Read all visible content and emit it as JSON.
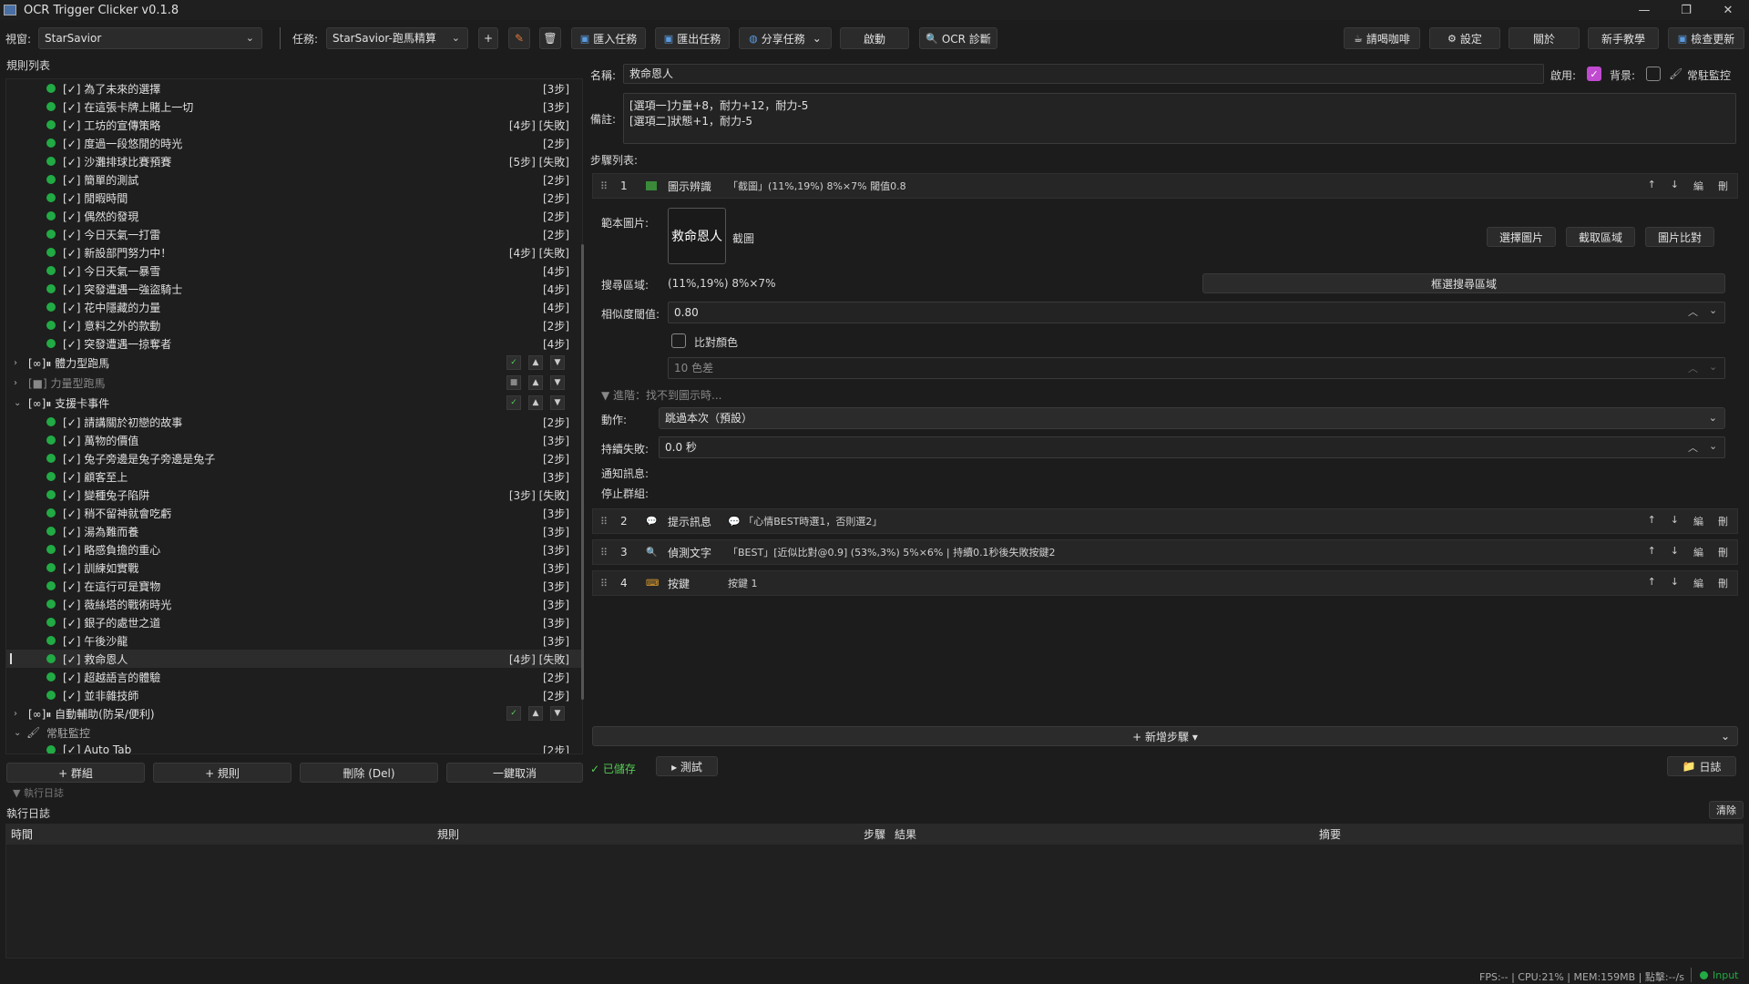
{
  "window": {
    "title": "OCR Trigger Clicker v0.1.8",
    "minimize": "—",
    "maximize": "❐",
    "close": "✕"
  },
  "toolbar": {
    "window_label": "視窗:",
    "window_value": "StarSavior",
    "task_label": "任務:",
    "task_value": "StarSavior-跑馬精算",
    "add": "+",
    "import": "匯入任務",
    "export": "匯出任務",
    "share": "分享任務",
    "start": "啟動",
    "ocr_diag": "OCR 診斷",
    "coffee": "請喝咖啡",
    "settings": "設定",
    "about": "關於",
    "tutorial": "新手教學",
    "update": "檢查更新"
  },
  "rules_title": "規則列表",
  "rules": [
    {
      "text": "[✓] 為了未來的選擇",
      "meta": "[3步]"
    },
    {
      "text": "[✓] 在這張卡牌上賭上一切",
      "meta": "[3步]"
    },
    {
      "text": "[✓] 工坊的宣傳策略",
      "meta": "[4步] [失敗]"
    },
    {
      "text": "[✓] 度過一段悠閒的時光",
      "meta": "[2步]"
    },
    {
      "text": "[✓] 沙灘排球比賽預賽",
      "meta": "[5步] [失敗]"
    },
    {
      "text": "[✓] 簡單的測試",
      "meta": "[2步]"
    },
    {
      "text": "[✓] 閒暇時間",
      "meta": "[2步]"
    },
    {
      "text": "[✓] 偶然的發現",
      "meta": "[2步]"
    },
    {
      "text": "[✓] 今日天氣一打雷",
      "meta": "[2步]"
    },
    {
      "text": "[✓] 新設部門努力中！",
      "meta": "[4步] [失敗]"
    },
    {
      "text": "[✓] 今日天氣一暴雪",
      "meta": "[4步]"
    },
    {
      "text": "[✓] 突發遭遇一強盜騎士",
      "meta": "[4步]"
    },
    {
      "text": "[✓] 花中隱藏的力量",
      "meta": "[4步]"
    },
    {
      "text": "[✓] 意料之外的款動",
      "meta": "[2步]"
    },
    {
      "text": "[✓] 突發遭遇一掠奪者",
      "meta": "[4步]"
    }
  ],
  "groups": {
    "g1": {
      "label": "[∞]⏸ 體力型跑馬"
    },
    "g2": {
      "label": "[■] 力量型跑馬"
    },
    "g3": {
      "label": "[∞]⏸ 支援卡事件"
    },
    "g4": {
      "label": "[∞]⏸ 自動輔助(防呆/便利)"
    },
    "g5": {
      "label": "常駐監控"
    }
  },
  "group_btns": {
    "ok": "✓",
    "up": "▲",
    "down": "▼",
    "stop": "■"
  },
  "rules2": [
    {
      "text": "[✓] 請講關於初戀的故事",
      "meta": "[2步]"
    },
    {
      "text": "[✓] 萬物的價值",
      "meta": "[3步]"
    },
    {
      "text": "[✓] 兔子旁邊是兔子旁邊是兔子",
      "meta": "[2步]"
    },
    {
      "text": "[✓] 顧客至上",
      "meta": "[3步]"
    },
    {
      "text": "[✓] 變種兔子陷阱",
      "meta": "[3步] [失敗]"
    },
    {
      "text": "[✓] 稍不留神就會吃虧",
      "meta": "[3步]"
    },
    {
      "text": "[✓] 湯為難而養",
      "meta": "[3步]"
    },
    {
      "text": "[✓] 略感負擔的重心",
      "meta": "[3步]"
    },
    {
      "text": "[✓] 訓練如實戰",
      "meta": "[3步]"
    },
    {
      "text": "[✓] 在這行可是寶物",
      "meta": "[3步]"
    },
    {
      "text": "[✓] 薇絲塔的戰術時光",
      "meta": "[3步]"
    },
    {
      "text": "[✓] 銀子的處世之道",
      "meta": "[3步]"
    },
    {
      "text": "[✓] 午後沙龍",
      "meta": "[3步]"
    },
    {
      "text": "[✓] 救命恩人",
      "meta": "[4步] [失敗]"
    },
    {
      "text": "[✓] 超越語言的體驗",
      "meta": "[2步]"
    },
    {
      "text": "[✓] 並非雜技師",
      "meta": "[2步]"
    }
  ],
  "auto_tab": {
    "text": "[✓] Auto Tab",
    "meta": "[2步]"
  },
  "bottom_btns": {
    "add_group": "+ 群組",
    "add_rule": "+ 規則",
    "delete": "刪除 (Del)",
    "cancel_all": "一鍵取消"
  },
  "detail": {
    "name_label": "名稱:",
    "name_value": "救命恩人",
    "enable_label": "啟用:",
    "bg_label": "背景:",
    "monitor_label": "常駐監控",
    "note_label": "備註:",
    "note_line1": "[選項一]力量+8，耐力+12，耐力-5",
    "note_line2": "[選項二]狀態+1，耐力-5",
    "steps_label": "步驟列表:"
  },
  "step1": {
    "num": "1",
    "name": "圖示辨識",
    "desc": "「截圖」(11%,19%) 8%×7% 閾值0.8",
    "template_label": "範本圖片:",
    "template_text": "救命恩人",
    "capture_label": "截圖",
    "choose_img": "選擇圖片",
    "capture_area": "截取區域",
    "img_compare": "圖片比對",
    "search_label": "搜尋區域:",
    "search_value": "(11%,19%) 8%×7%",
    "frame_search": "框選搜尋區域",
    "threshold_label": "相似度閾值:",
    "threshold_value": "0.80",
    "color_compare": "比對顏色",
    "color_diff": "10 色差",
    "advanced": "▼ 進階：找不到圖示時...",
    "action_label": "動作:",
    "action_value": "跳過本次（預設）",
    "fail_label": "持續失敗:",
    "fail_value": "0.0 秒",
    "notify_label": "通知訊息:",
    "stop_group_label": "停止群組:"
  },
  "steps": [
    {
      "num": "2",
      "name": "提示訊息",
      "desc": "「心情BEST時選1，否則選2」"
    },
    {
      "num": "3",
      "name": "偵測文字",
      "desc": "「BEST」[近似比對@0.9] (53%,3%) 5%×6% | 持續0.1秒後失敗按鍵2"
    },
    {
      "num": "4",
      "name": "按鍵",
      "desc": "按鍵 1"
    }
  ],
  "step_acts": {
    "up": "↑",
    "down": "↓",
    "edit": "編",
    "del": "刪"
  },
  "add_step": "+ 新增步驟 ▾",
  "saved": "✓ 已儲存",
  "test": "▸ 測試",
  "log_btn": "日誌",
  "log": {
    "collapse": "▼ 執行日誌",
    "title": "執行日誌",
    "clear": "清除",
    "cols": [
      "時間",
      "規則",
      "步驟",
      "結果",
      "摘要"
    ]
  },
  "status": {
    "stats": "FPS:-- | CPU:21% | MEM:159MB | 點擊:--/s",
    "input": "Input"
  },
  "colors": {
    "accent": "#c04ad0",
    "ok": "#22aa44",
    "bg": "#1c1c1c"
  }
}
